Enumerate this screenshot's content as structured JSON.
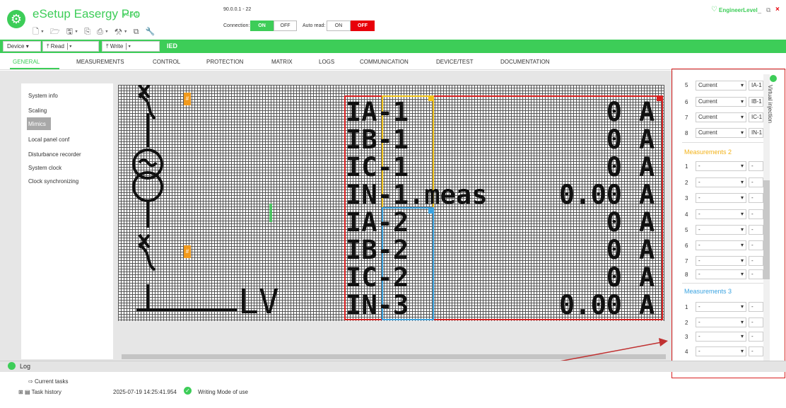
{
  "app": {
    "name": "eSetup Easergy Pro",
    "version": "v4.9.1",
    "ip": "90.0.0.1 - 22"
  },
  "connection": {
    "label": "Connection:",
    "on": "ON",
    "off": "OFF",
    "state": "ON"
  },
  "auto_read": {
    "label": "Auto read:",
    "on": "ON",
    "off": "OFF",
    "state": "OFF"
  },
  "user": {
    "level": "EngineerLevel"
  },
  "window": {
    "min": "_",
    "max": "⧉",
    "close": "×"
  },
  "toolbar": {
    "device": "Device",
    "read": "Read",
    "write": "Write",
    "ied": "IED"
  },
  "tabs": [
    "GENERAL",
    "MEASUREMENTS",
    "CONTROL",
    "PROTECTION",
    "MATRIX",
    "LOGS",
    "COMMUNICATION",
    "DEVICE/TEST",
    "DOCUMENTATION"
  ],
  "active_tab": "GENERAL",
  "sidebar": {
    "items": [
      "System info",
      "Scaling",
      "Mimics",
      "Local panel conf",
      "Disturbance recorder",
      "System clock",
      "Clock synchronizing"
    ],
    "selected": "Mimics"
  },
  "mimic": {
    "rows": [
      {
        "name": "IA-1",
        "value": "0",
        "unit": "A"
      },
      {
        "name": "IB-1",
        "value": "0",
        "unit": "A"
      },
      {
        "name": "IC-1",
        "value": "0",
        "unit": "A"
      },
      {
        "name": "IN-1.meas",
        "value": "0.00",
        "unit": "A"
      },
      {
        "name": "IA-2",
        "value": "0",
        "unit": "A"
      },
      {
        "name": "IB-2",
        "value": "0",
        "unit": "A"
      },
      {
        "name": "IC-2",
        "value": "0",
        "unit": "A"
      },
      {
        "name": "IN-3",
        "value": "0.00",
        "unit": "A"
      }
    ],
    "lv_label": "LV",
    "marker_text": "#"
  },
  "right_panel": {
    "top_rows": [
      {
        "num": "5",
        "type": "Current",
        "ref": "IA-1"
      },
      {
        "num": "6",
        "type": "Current",
        "ref": "IB-1"
      },
      {
        "num": "7",
        "type": "Current",
        "ref": "IC-1"
      },
      {
        "num": "8",
        "type": "Current",
        "ref": "IN-1"
      }
    ],
    "meas2": {
      "title": "Measurements 2",
      "rows": [
        {
          "num": "1",
          "a": "-",
          "b": "-"
        },
        {
          "num": "2",
          "a": "-",
          "b": "-"
        },
        {
          "num": "3",
          "a": "-",
          "b": "-"
        },
        {
          "num": "4",
          "a": "-",
          "b": "-"
        },
        {
          "num": "5",
          "a": "-",
          "b": "-"
        },
        {
          "num": "6",
          "a": "-",
          "b": "-"
        },
        {
          "num": "7",
          "a": "-",
          "b": "-"
        },
        {
          "num": "8",
          "a": "-",
          "b": "-"
        }
      ]
    },
    "meas3": {
      "title": "Measurements 3",
      "rows": [
        {
          "num": "1",
          "a": "-",
          "b": "-"
        },
        {
          "num": "2",
          "a": "-",
          "b": "-"
        },
        {
          "num": "3",
          "a": "-",
          "b": "-"
        },
        {
          "num": "4",
          "a": "-",
          "b": "-"
        }
      ]
    },
    "virtual_injection": "Virtual injection"
  },
  "log": {
    "title": "Log",
    "current_tasks": "Current tasks",
    "task_history": "Task history",
    "entry_time": "2025-07-19 14:25:41.954",
    "entry_text": "Writing Mode of use"
  },
  "colors": {
    "brand": "#3dcd58",
    "red": "#d92020",
    "yellow": "#f2c31a",
    "blue": "#3ba3e0",
    "orange": "#f29a1c"
  }
}
